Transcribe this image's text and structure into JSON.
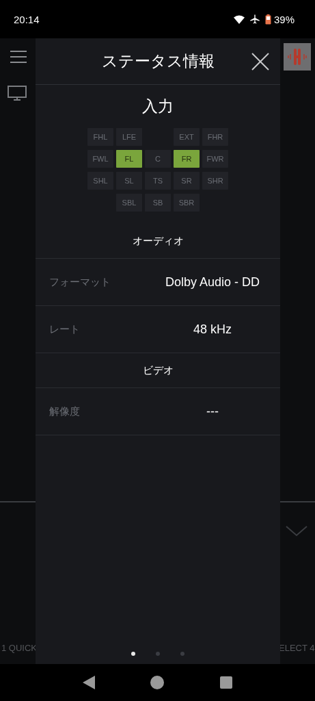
{
  "status_bar": {
    "time": "20:14",
    "battery": "39%"
  },
  "background": {
    "bottom_left": "1 QUICK",
    "bottom_right": "ELECT 4"
  },
  "dialog": {
    "title": "ステータス情報",
    "heading": "入力",
    "channel_rows": [
      [
        {
          "kind": "channel",
          "label": "FHL",
          "active": false
        },
        {
          "kind": "channel",
          "label": "LFE",
          "active": false
        },
        {
          "kind": "empty"
        },
        {
          "kind": "channel",
          "label": "EXT",
          "active": false
        },
        {
          "kind": "channel",
          "label": "FHR",
          "active": false
        }
      ],
      [
        {
          "kind": "channel",
          "label": "FWL",
          "active": false
        },
        {
          "kind": "channel",
          "label": "FL",
          "active": true
        },
        {
          "kind": "channel",
          "label": "C",
          "active": false
        },
        {
          "kind": "channel",
          "label": "FR",
          "active": true
        },
        {
          "kind": "channel",
          "label": "FWR",
          "active": false
        }
      ],
      [
        {
          "kind": "channel",
          "label": "SHL",
          "active": false
        },
        {
          "kind": "channel",
          "label": "SL",
          "active": false
        },
        {
          "kind": "channel",
          "label": "TS",
          "active": false
        },
        {
          "kind": "channel",
          "label": "SR",
          "active": false
        },
        {
          "kind": "channel",
          "label": "SHR",
          "active": false
        }
      ],
      [
        {
          "kind": "empty"
        },
        {
          "kind": "channel",
          "label": "SBL",
          "active": false
        },
        {
          "kind": "channel",
          "label": "SB",
          "active": false
        },
        {
          "kind": "channel",
          "label": "SBR",
          "active": false
        },
        {
          "kind": "empty"
        }
      ]
    ],
    "items": [
      {
        "kind": "section",
        "label": "オーディオ"
      },
      {
        "kind": "field",
        "label": "フォーマット",
        "value": "Dolby Audio - DD"
      },
      {
        "kind": "field",
        "label": "レート",
        "value": "48 kHz"
      },
      {
        "kind": "section",
        "label": "ビデオ"
      },
      {
        "kind": "field",
        "label": "解像度",
        "value": "---"
      }
    ],
    "pages": [
      {
        "selected": true
      },
      {
        "selected": false
      },
      {
        "selected": false
      }
    ]
  }
}
